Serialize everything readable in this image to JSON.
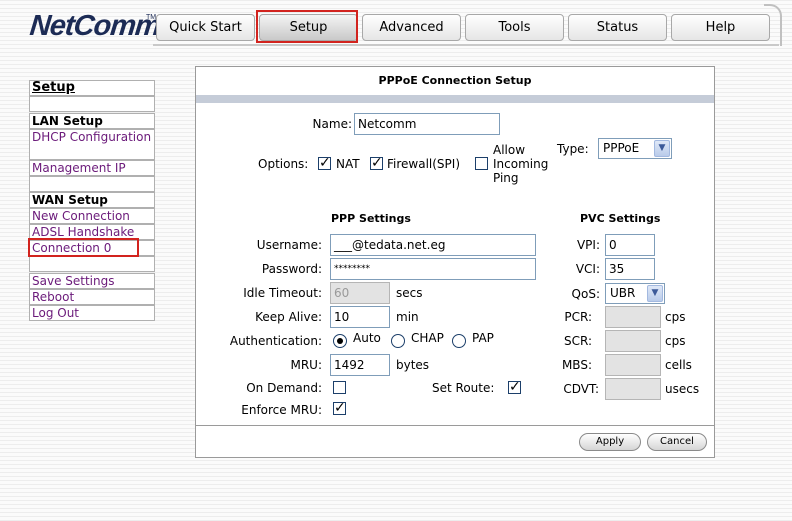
{
  "logo": {
    "text": "NetComm",
    "tm": "TM"
  },
  "tabs": [
    {
      "label": "Quick Start"
    },
    {
      "label": "Setup"
    },
    {
      "label": "Advanced"
    },
    {
      "label": "Tools"
    },
    {
      "label": "Status"
    },
    {
      "label": "Help"
    }
  ],
  "sidebar": {
    "title": "Setup",
    "lan_header": "LAN Setup",
    "dhcp": "DHCP Configuration",
    "management_ip": "Management IP",
    "wan_header": "WAN Setup",
    "new_connection": "New Connection",
    "adsl_handshake": "ADSL Handshake",
    "connection0": "Connection 0",
    "save_settings": "Save Settings",
    "reboot": "Reboot",
    "logout": "Log Out"
  },
  "panel": {
    "title": "PPPoE Connection Setup",
    "name_label": "Name:",
    "name_value": "Netcomm",
    "options_label": "Options:",
    "nat_label": "NAT",
    "firewall_label": "Firewall(SPI)",
    "allow_ping_label_1": "Allow",
    "allow_ping_label_2": "Incoming",
    "allow_ping_label_3": "Ping",
    "type_label": "Type:",
    "type_value": "PPPoE"
  },
  "ppp": {
    "heading": "PPP Settings",
    "username_label": "Username:",
    "username_value": "___@tedata.net.eg",
    "password_label": "Password:",
    "password_value": "********",
    "idle_label": "Idle Timeout:",
    "idle_value": "60",
    "idle_unit": "secs",
    "keepalive_label": "Keep Alive:",
    "keepalive_value": "10",
    "keepalive_unit": "min",
    "auth_label": "Authentication:",
    "auth_auto": "Auto",
    "auth_chap": "CHAP",
    "auth_pap": "PAP",
    "mru_label": "MRU:",
    "mru_value": "1492",
    "mru_unit": "bytes",
    "ondemand_label": "On Demand:",
    "setroute_label": "Set Route:",
    "enforce_label": "Enforce MRU:"
  },
  "pvc": {
    "heading": "PVC Settings",
    "vpi_label": "VPI:",
    "vpi_value": "0",
    "vci_label": "VCI:",
    "vci_value": "35",
    "qos_label": "QoS:",
    "qos_value": "UBR",
    "pcr_label": "PCR:",
    "pcr_unit": "cps",
    "scr_label": "SCR:",
    "scr_unit": "cps",
    "mbs_label": "MBS:",
    "mbs_unit": "cells",
    "cdvt_label": "CDVT:",
    "cdvt_unit": "usecs"
  },
  "buttons": {
    "apply": "Apply",
    "cancel": "Cancel"
  },
  "state": {
    "nat_checked": true,
    "firewall_checked": true,
    "allow_ping_checked": false,
    "auth_selected": "Auto",
    "on_demand_checked": false,
    "set_route_checked": true,
    "enforce_mru_checked": true
  },
  "colors": {
    "highlight": "#d2231e",
    "link": "#6b1a7a",
    "brand": "#1c2b55"
  }
}
